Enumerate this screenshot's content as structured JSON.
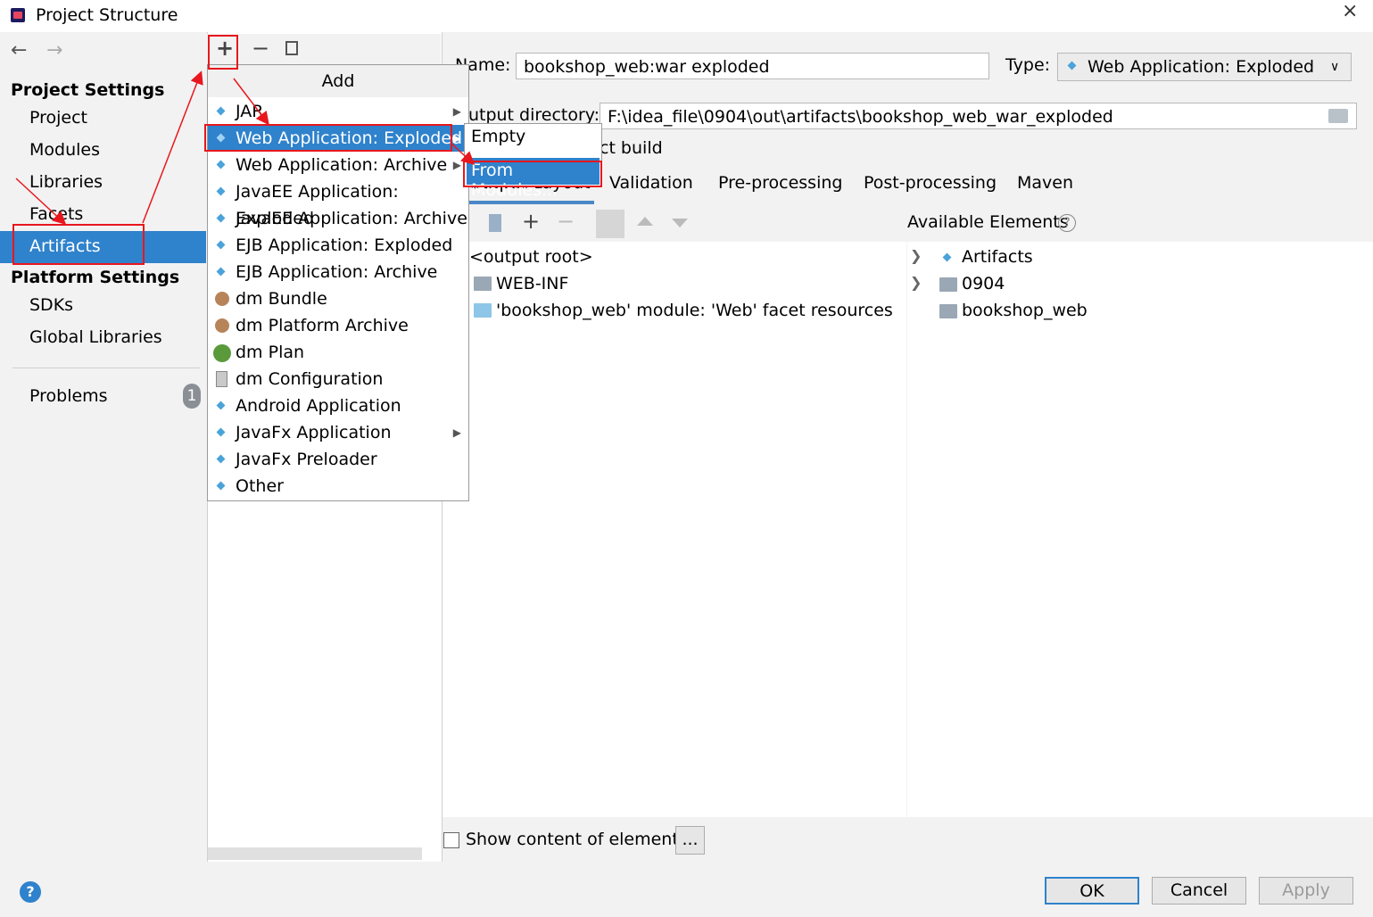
{
  "window": {
    "title": "Project Structure",
    "close": "×"
  },
  "sidebar": {
    "project_settings": "Project Settings",
    "items": [
      "Project",
      "Modules",
      "Libraries",
      "Facets",
      "Artifacts"
    ],
    "platform_settings": "Platform Settings",
    "platform_items": [
      "SDKs",
      "Global Libraries"
    ],
    "problems": "Problems",
    "problems_count": "1"
  },
  "toolbar": {
    "back": "←",
    "forward": "→",
    "add": "+",
    "remove": "−"
  },
  "artifact": {
    "name_label": "Name:",
    "name_value": "bookshop_web:war exploded",
    "type_label": "Type:",
    "type_value": "Web Application: Exploded",
    "output_label": "Output directory:",
    "output_value": "F:\\idea_file\\0904\\out\\artifacts\\bookshop_web_war_exploded",
    "build_label": "ct build"
  },
  "tabs": [
    "Output Layout",
    "Validation",
    "Pre-processing",
    "Post-processing",
    "Maven"
  ],
  "layout_tree": [
    "<output root>",
    "WEB-INF",
    "'bookshop_web' module: 'Web' facet resources"
  ],
  "available": {
    "title": "Available Elements",
    "items": [
      "Artifacts",
      "0904",
      "bookshop_web"
    ]
  },
  "show_content": "Show content of elements",
  "ellipsis": "...",
  "buttons": {
    "ok": "OK",
    "cancel": "Cancel",
    "apply": "Apply"
  },
  "add_menu": {
    "header": "Add",
    "items": [
      "JAR",
      "Web Application: Exploded",
      "Web Application: Archive",
      "JavaEE Application: Exploded",
      "JavaEE Application: Archive",
      "EJB Application: Exploded",
      "EJB Application: Archive",
      "dm Bundle",
      "dm Platform Archive",
      "dm Plan",
      "dm Configuration",
      "Android Application",
      "JavaFx Application",
      "JavaFx Preloader",
      "Other"
    ]
  },
  "sub_menu": {
    "items": [
      "Empty",
      "From Modules..."
    ]
  },
  "colors": {
    "selection": "#2f82cc",
    "annotation": "#e8171d"
  }
}
